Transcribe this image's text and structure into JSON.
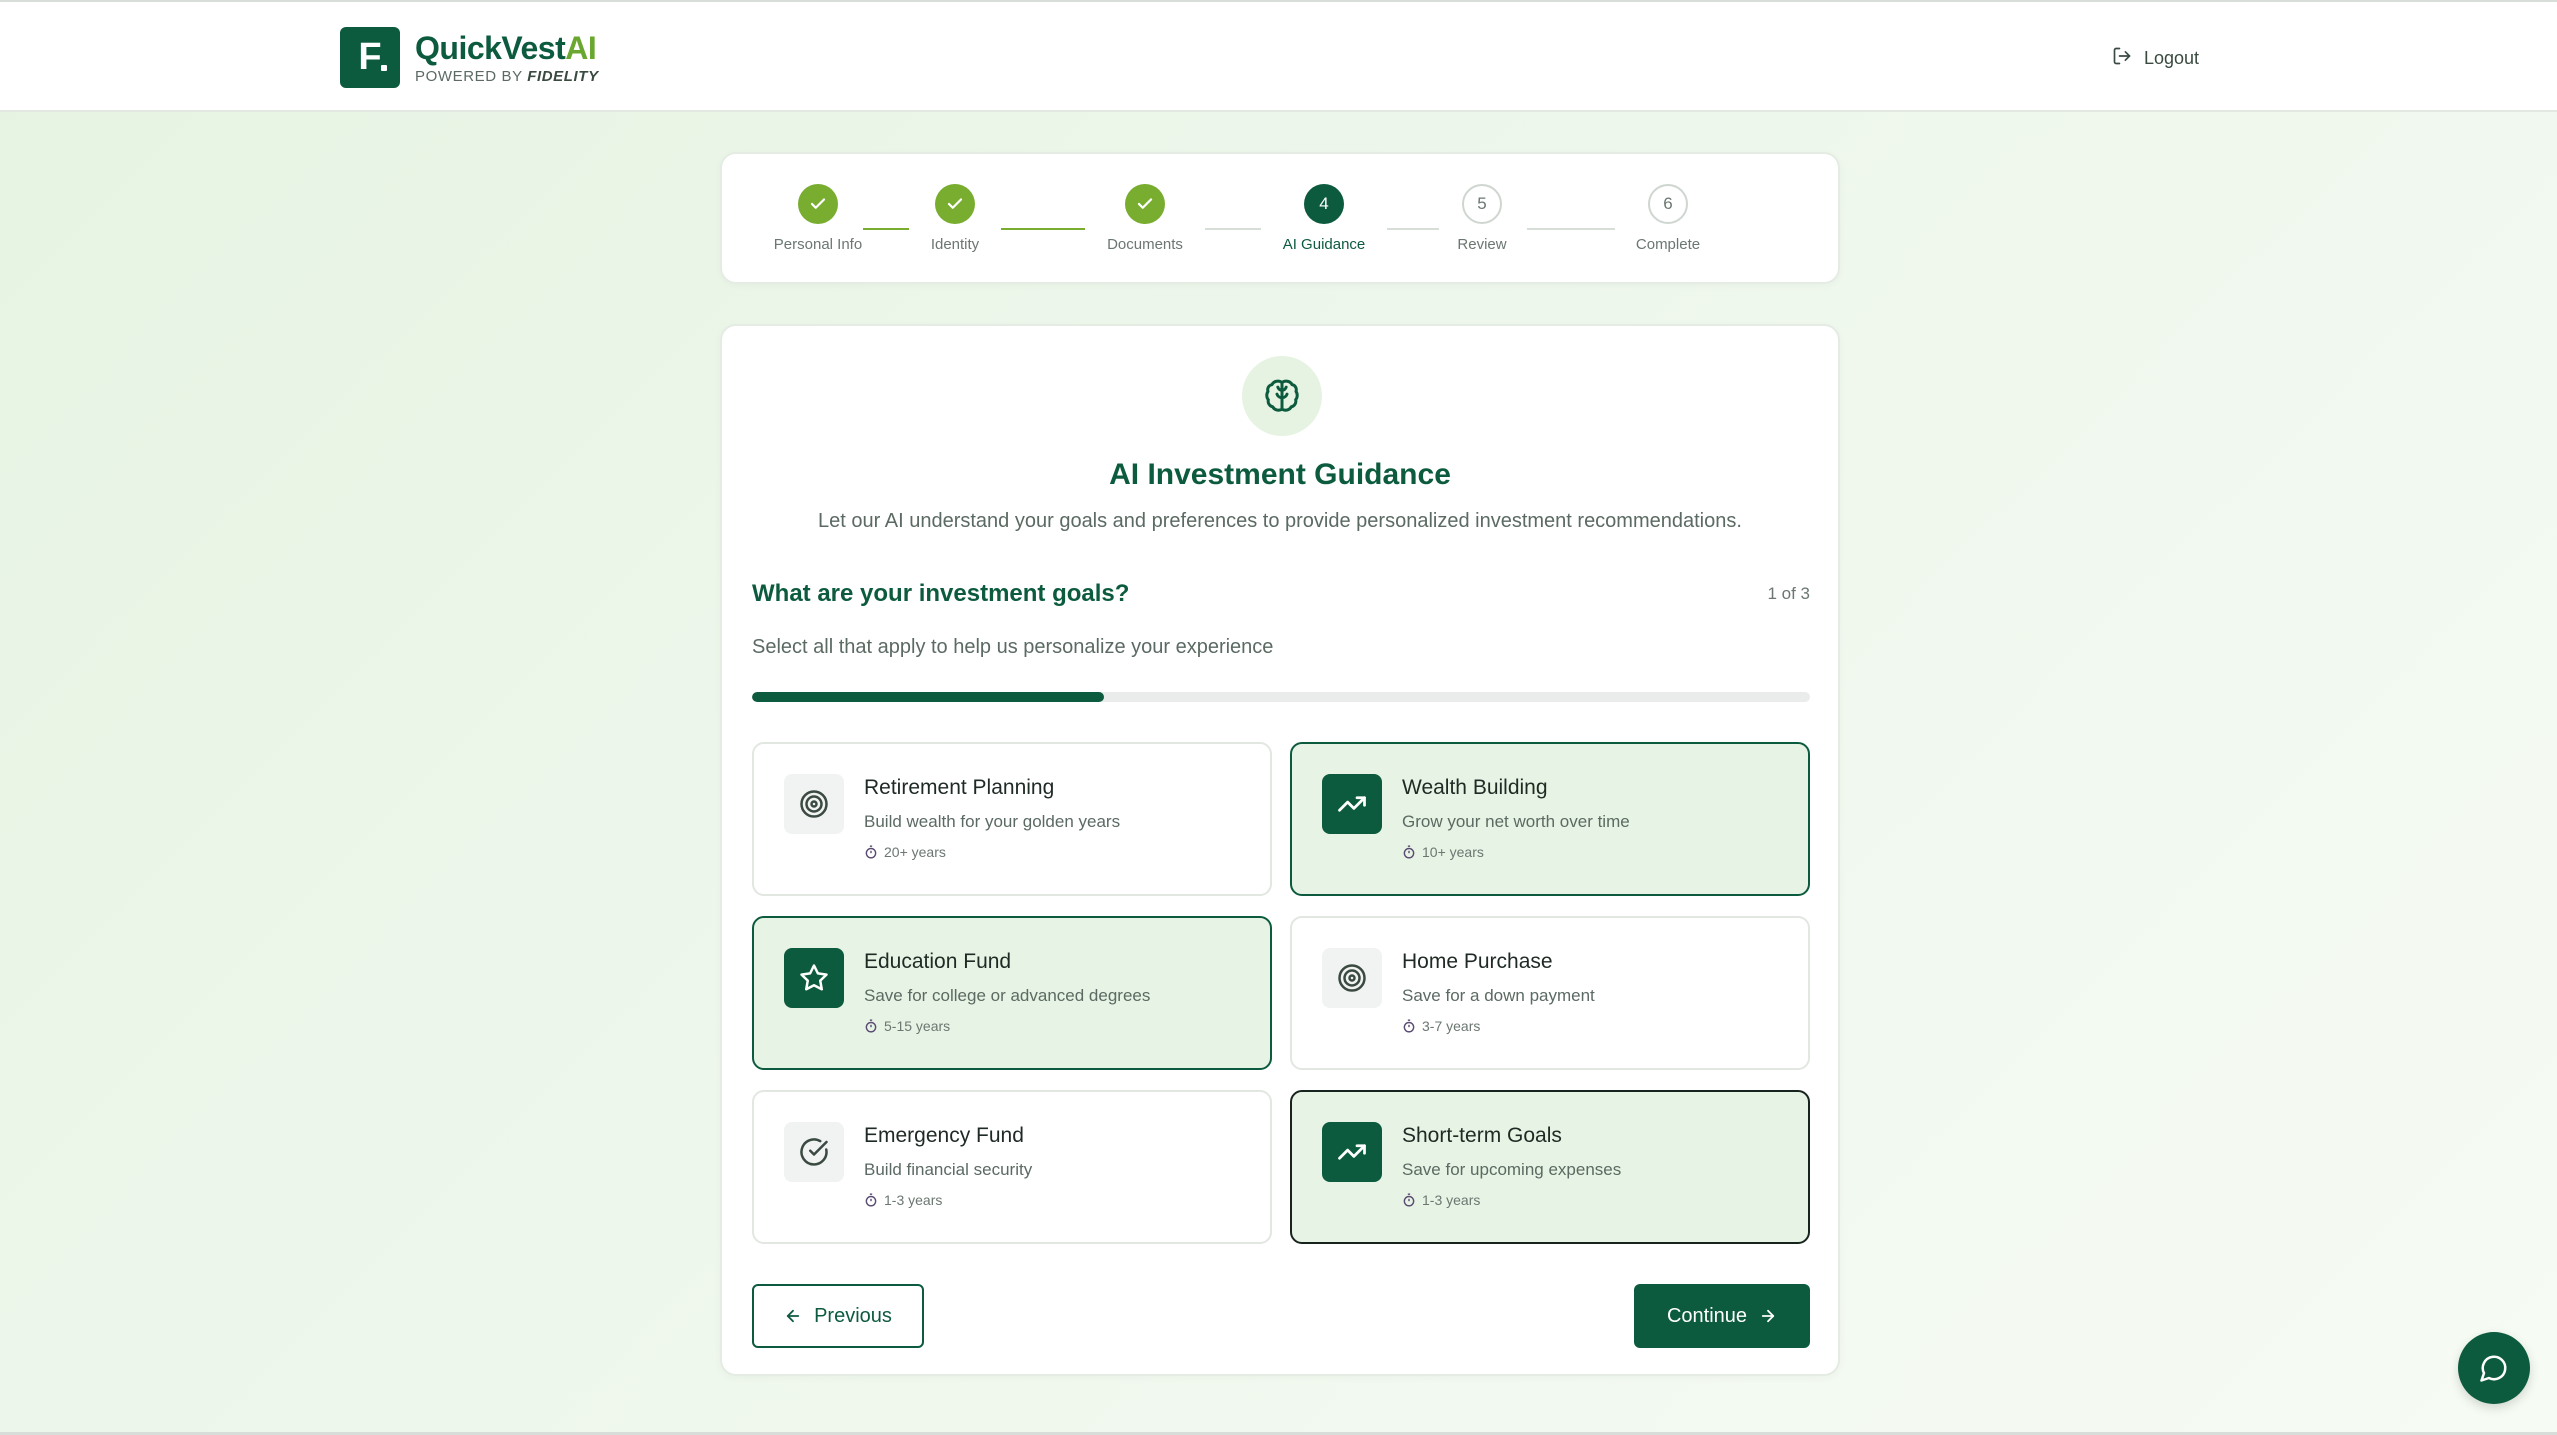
{
  "header": {
    "brand_main": "QuickVest",
    "brand_ai": "AI",
    "powered_prefix": "POWERED BY",
    "powered_name": "FIDELITY",
    "logo_letter": "F",
    "logout_label": "Logout"
  },
  "stepper": {
    "steps": [
      {
        "number": "1",
        "label": "Personal Info",
        "state": "completed"
      },
      {
        "number": "2",
        "label": "Identity",
        "state": "completed"
      },
      {
        "number": "3",
        "label": "Documents",
        "state": "completed"
      },
      {
        "number": "4",
        "label": "AI Guidance",
        "state": "active"
      },
      {
        "number": "5",
        "label": "Review",
        "state": "pending"
      },
      {
        "number": "6",
        "label": "Complete",
        "state": "pending"
      }
    ]
  },
  "main": {
    "icon": "brain-icon",
    "title": "AI Investment Guidance",
    "subtitle": "Let our AI understand your goals and preferences to provide personalized investment recommendations.",
    "question": "What are your investment goals?",
    "question_count": "1 of 3",
    "question_help": "Select all that apply to help us personalize your experience",
    "progress_fraction": 0.333
  },
  "options": [
    {
      "title": "Retirement Planning",
      "desc": "Build wealth for your golden years",
      "years": "20+ years",
      "icon": "target-icon",
      "selected": false
    },
    {
      "title": "Wealth Building",
      "desc": "Grow your net worth over time",
      "years": "10+ years",
      "icon": "trending-up-icon",
      "selected": true
    },
    {
      "title": "Education Fund",
      "desc": "Save for college or advanced degrees",
      "years": "5-15 years",
      "icon": "star-icon",
      "selected": true
    },
    {
      "title": "Home Purchase",
      "desc": "Save for a down payment",
      "years": "3-7 years",
      "icon": "target-icon",
      "selected": false
    },
    {
      "title": "Emergency Fund",
      "desc": "Build financial security",
      "years": "1-3 years",
      "icon": "check-circle-icon",
      "selected": false
    },
    {
      "title": "Short-term Goals",
      "desc": "Save for upcoming expenses",
      "years": "1-3 years",
      "icon": "trending-up-icon",
      "selected": true
    }
  ],
  "buttons": {
    "previous_label": "Previous",
    "continue_label": "Continue"
  },
  "colors": {
    "brand_dark": "#0d5b3e",
    "brand_accent": "#78ad2f",
    "selected_bg": "#e7f3e4"
  }
}
